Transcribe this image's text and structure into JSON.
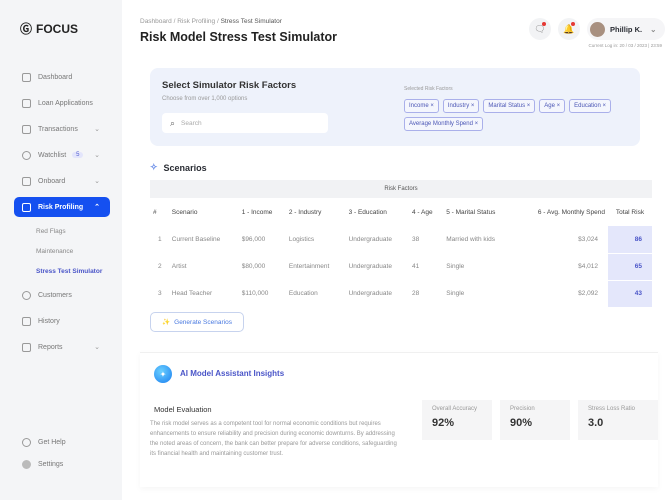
{
  "brand": "FOCUS",
  "sidebar": {
    "items": [
      {
        "label": "Dashboard"
      },
      {
        "label": "Loan Applications"
      },
      {
        "label": "Transactions"
      },
      {
        "label": "Watchlist",
        "badge": "5"
      },
      {
        "label": "Onboard"
      },
      {
        "label": "Risk Profiling"
      },
      {
        "label": "Customers"
      },
      {
        "label": "History"
      },
      {
        "label": "Reports"
      }
    ],
    "sub": [
      "Red Flags",
      "Maintenance",
      "Stress Test Simulator"
    ],
    "footer": [
      "Get Help",
      "Settings"
    ]
  },
  "header": {
    "crumbs": [
      "Dashboard",
      "Risk Profiling",
      "Stress Test Simulator"
    ],
    "title": "Risk Model Stress Test Simulator",
    "user": "Phillip K.",
    "login": "Current Log in: 20 / 03 / 2023 | 23:59"
  },
  "filter": {
    "title": "Select Simulator Risk Factors",
    "subtitle": "Choose from over 1,000 options",
    "search_placeholder": "Search",
    "selected_label": "Selected Risk Factors",
    "chips": [
      "Income",
      "Industry",
      "Marital Status",
      "Age",
      "Education",
      "Average Monthly Spend"
    ]
  },
  "scenarios": {
    "title": "Scenarios",
    "group_header": "Risk Factors",
    "columns": [
      "#",
      "Scenario",
      "1 - Income",
      "2 - Industry",
      "3 - Education",
      "4 - Age",
      "5 - Marital Status",
      "6 - Avg. Monthly Spend",
      "Total Risk"
    ],
    "rows": [
      [
        "1",
        "Current Baseline",
        "$96,000",
        "Logistics",
        "Undergraduate",
        "38",
        "Married with kids",
        "$3,024",
        "86"
      ],
      [
        "2",
        "Artist",
        "$80,000",
        "Entertainment",
        "Undergraduate",
        "41",
        "Single",
        "$4,012",
        "65"
      ],
      [
        "3",
        "Head Teacher",
        "$110,000",
        "Education",
        "Undergraduate",
        "28",
        "Single",
        "$2,092",
        "43"
      ]
    ],
    "generate": "Generate Scenarios"
  },
  "insights": {
    "title": "AI Model Assistant Insights",
    "eval_title": "Model Evaluation",
    "eval_text": "The risk model serves as a competent tool for normal economic conditions but requires enhancements to ensure reliability and precision during economic downturns. By addressing the noted areas of concern, the bank can better prepare for adverse conditions, safeguarding its financial health and maintaining customer trust.",
    "stats": [
      {
        "label": "Overall Accuracy",
        "value": "92%"
      },
      {
        "label": "Precision",
        "value": "90%"
      },
      {
        "label": "Stress Loss Ratio",
        "value": "3.0"
      }
    ]
  }
}
